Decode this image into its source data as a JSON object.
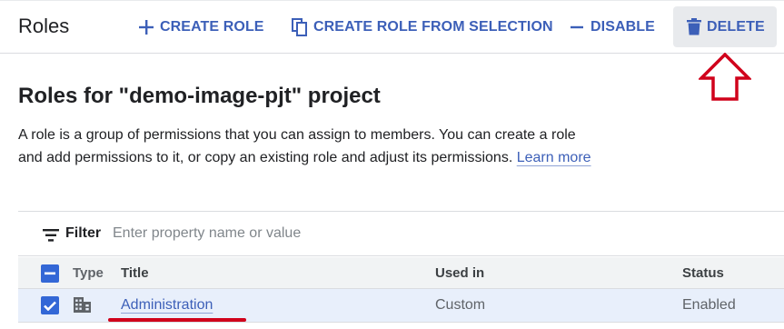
{
  "toolbar": {
    "page_title": "Roles",
    "create_role_label": "CREATE ROLE",
    "create_from_selection_label": "CREATE ROLE FROM SELECTION",
    "disable_label": "DISABLE",
    "delete_label": "DELETE"
  },
  "main": {
    "heading": "Roles for \"demo-image-pjt\" project",
    "description": "A role is a group of permissions that you can assign to members. You can create a role and add permissions to it, or copy an existing role and adjust its permissions.",
    "learn_more_label": "Learn more"
  },
  "filter": {
    "label": "Filter",
    "placeholder": "Enter property name or value"
  },
  "table": {
    "columns": [
      "Type",
      "Title",
      "Used in",
      "Status"
    ],
    "header_checkbox_state": "indeterminate",
    "rows": [
      {
        "selected": true,
        "type_icon": "building-icon",
        "title": "Administration",
        "used_in": "Custom",
        "status": "Enabled"
      }
    ]
  },
  "colors": {
    "accent": "#3c5fb8",
    "annotation": "#d0021b",
    "selected_row": "#e8effb"
  }
}
